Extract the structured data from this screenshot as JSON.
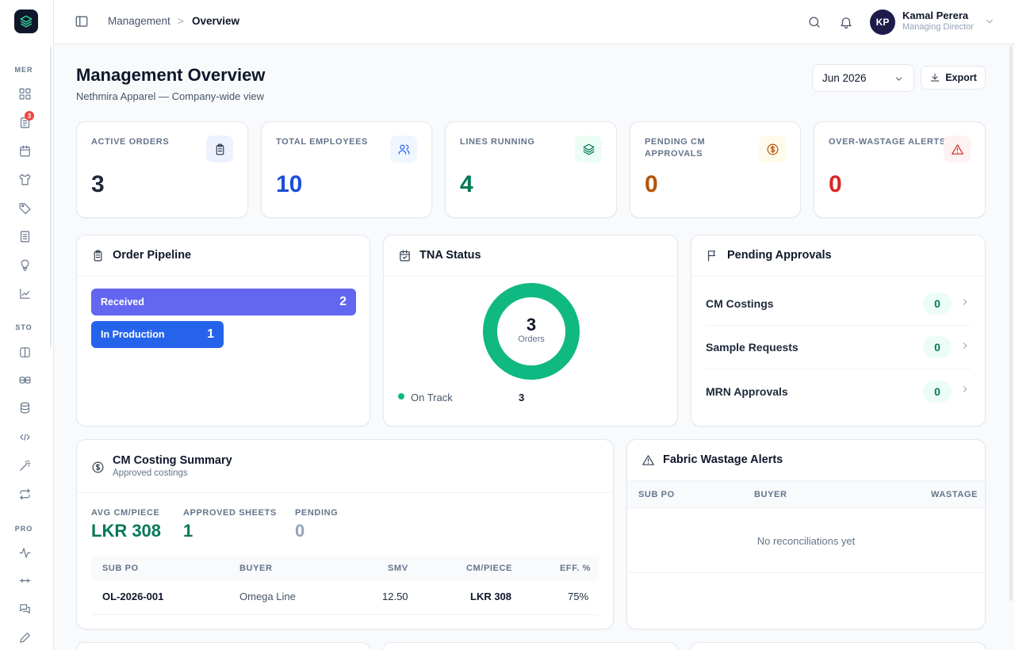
{
  "sidebar": {
    "sections": [
      "MER",
      "STO",
      "PRO"
    ],
    "badge_count": "3",
    "icons": [
      "dashboard-icon",
      "orders-icon",
      "calendar-icon",
      "garment-icon",
      "tag-icon",
      "document-icon",
      "lightbulb-icon",
      "chart-icon",
      "book-icon",
      "ticket-icon",
      "database-icon",
      "transfer-icon",
      "wand-icon",
      "repeat-icon",
      "activity-icon",
      "line-icon",
      "chat-icon",
      "pencil-icon"
    ]
  },
  "header": {
    "breadcrumb_parent": "Management",
    "breadcrumb_sep": ">",
    "breadcrumb_current": "Overview",
    "user_initials": "KP",
    "user_name": "Kamal Perera",
    "user_role": "Managing Director"
  },
  "page": {
    "title": "Management Overview",
    "subtitle": "Nethmira Apparel — Company-wide view",
    "month": "Jun 2026",
    "export_label": "Export"
  },
  "stats": [
    {
      "label": "ACTIVE ORDERS",
      "value": "3",
      "color": "#1e293b",
      "icon": "clipboard-icon",
      "icon_bg": "#eef2ff",
      "icon_color": "#334155"
    },
    {
      "label": "TOTAL EMPLOYEES",
      "value": "10",
      "color": "#1d4ed8",
      "icon": "users-icon",
      "icon_bg": "#eff6ff",
      "icon_color": "#2563eb"
    },
    {
      "label": "LINES RUNNING",
      "value": "4",
      "color": "#047857",
      "icon": "layers-icon",
      "icon_bg": "#ecfdf5",
      "icon_color": "#047857"
    },
    {
      "label": "PENDING CM APPROVALS",
      "value": "0",
      "color": "#b45309",
      "icon": "dollar-icon",
      "icon_bg": "#fffbeb",
      "icon_color": "#b45309"
    },
    {
      "label": "OVER-WASTAGE ALERTS",
      "value": "0",
      "color": "#dc2626",
      "icon": "alert-icon",
      "icon_bg": "#fef2f2",
      "icon_color": "#dc2626"
    }
  ],
  "pipeline": {
    "title": "Order Pipeline",
    "stages": [
      {
        "label": "Received",
        "value": "2",
        "fraction": 1.0,
        "color": "#6366f1"
      },
      {
        "label": "In Production",
        "value": "1",
        "fraction": 0.5,
        "color": "#2563eb"
      }
    ]
  },
  "tna": {
    "title": "TNA Status",
    "total": "3",
    "total_label": "Orders",
    "legend": [
      {
        "label": "On Track",
        "value": "3",
        "color": "#10b981"
      }
    ]
  },
  "approvals": {
    "title": "Pending Approvals",
    "items": [
      {
        "label": "CM Costings",
        "count": "0"
      },
      {
        "label": "Sample Requests",
        "count": "0"
      },
      {
        "label": "MRN Approvals",
        "count": "0"
      }
    ]
  },
  "cm_costing": {
    "title": "CM Costing Summary",
    "subtitle": "Approved costings",
    "metrics": [
      {
        "label": "AVG CM/PIECE",
        "value": "LKR 308",
        "color": "#047857"
      },
      {
        "label": "APPROVED SHEETS",
        "value": "1",
        "color": "#047857"
      },
      {
        "label": "PENDING",
        "value": "0",
        "color": "#94a3b8"
      }
    ],
    "columns": [
      "SUB PO",
      "BUYER",
      "SMV",
      "CM/PIECE",
      "EFF. %"
    ],
    "rows": [
      {
        "sub_po": "OL-2026-001",
        "buyer": "Omega Line",
        "smv": "12.50",
        "cm_piece": "LKR 308",
        "eff": "75%"
      }
    ]
  },
  "wastage": {
    "title": "Fabric Wastage Alerts",
    "columns": [
      "SUB PO",
      "BUYER",
      "WASTAGE"
    ],
    "empty": "No reconciliations yet"
  }
}
